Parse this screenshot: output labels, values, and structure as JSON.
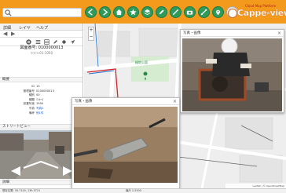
{
  "toolbar": {
    "search_placeholder": "",
    "tool_icons": [
      "back-arrow-icon",
      "forward-arrow-icon",
      "home-icon",
      "star-icon",
      "layers-icon",
      "edit-icon",
      "measure-icon",
      "camera-icon",
      "route-icon",
      "location-icon",
      "settings-icon",
      "grid-icon",
      "help-icon"
    ],
    "accent_color": "#f39a1c",
    "tool_color": "#2e9a5b"
  },
  "logo": {
    "tagline": "Cloud Map Platform",
    "name": "Cappe-view"
  },
  "left_panel": {
    "menu": [
      "詳細",
      "レイヤ",
      "ヘルプ"
    ],
    "record_title": "図面番号: 0100000013",
    "record_sub": "ﾏﾝﾎｰﾙ 01-1050",
    "section_basic": "概要",
    "properties": [
      {
        "key": "ID",
        "value": "13"
      },
      {
        "key": "管理番号",
        "value": "0100000013"
      },
      {
        "key": "種別",
        "value": "00"
      },
      {
        "key": "種類",
        "value": "ﾏﾝﾎｰﾙ"
      },
      {
        "key": "設置年度",
        "value": "1990"
      },
      {
        "key": "写真",
        "value": "写真1"
      },
      {
        "key": "備考",
        "value": "他1件"
      }
    ],
    "section_streetview": "ストリートビュー",
    "section_bottom": "詳細"
  },
  "popups": {
    "photo1_title": "写真・画像",
    "photo2_title": "写真・画像",
    "close": "×"
  },
  "map": {
    "park_label": "緑地公園",
    "zoom_in": "+",
    "zoom_out": "−"
  },
  "status": {
    "left": "現在位置: 35.7120, 139.3721",
    "center": "縮尺 1:2500",
    "attribution": "Leaflet | © OpenStreetMap"
  }
}
